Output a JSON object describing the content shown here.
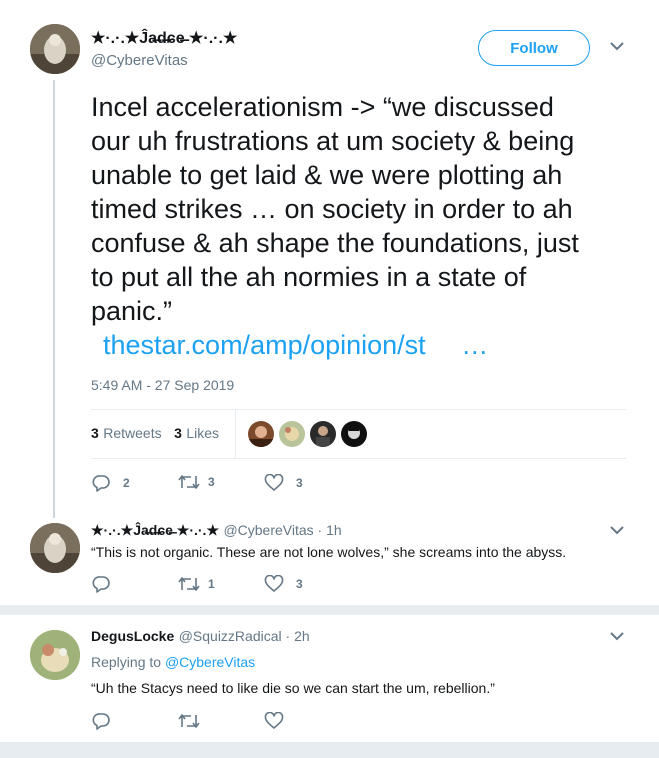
{
  "main_tweet": {
    "display_name": "★·.·.★Ĵa̶d̶ɕe̶ ★·.·.★",
    "handle": "@CybereVitas",
    "follow_label": "Follow",
    "text_lines": [
      "Incel accelerationism -> “we discussed",
      "our uh frustrations at um society & being",
      "unable to get laid & we were plotting ah",
      "timed strikes … on society in order to ah",
      "confuse & ah shape the foundations, just",
      "to put all the ah normies in a state of",
      "panic.”"
    ],
    "link_text": "thestar.com/amp/opinion/st",
    "link_ellipsis": "…",
    "timestamp": "5:49 AM - 27 Sep 2019",
    "retweets_count": "3",
    "retweets_label": "Retweets",
    "likes_count": "3",
    "likes_label": "Likes",
    "actions": {
      "replies": "2",
      "retweets": "3",
      "likes": "3"
    }
  },
  "reply1": {
    "display_name": "★·.·.★Ĵa̶d̶ɕe̶ ★·.·.★",
    "handle_time": "@CybereVitas · 1h",
    "text": "“This is not organic. These are not lone wolves,” she screams into the abyss.",
    "actions": {
      "replies": "",
      "retweets": "1",
      "likes": "3"
    }
  },
  "reply2": {
    "display_name": "DegusLocke",
    "handle_time": "@SquizzRadical · 2h",
    "replying_prefix": "Replying to ",
    "replying_to": "@CybereVitas",
    "text": "“Uh the Stacys need to like die so we can start the um, rebellion.”"
  },
  "colors": {
    "accent": "#1da1f2",
    "muted": "#657786",
    "divider": "#e6ecf0"
  },
  "icons": [
    "chevron-down-icon",
    "reply-icon",
    "retweet-icon",
    "like-icon"
  ]
}
